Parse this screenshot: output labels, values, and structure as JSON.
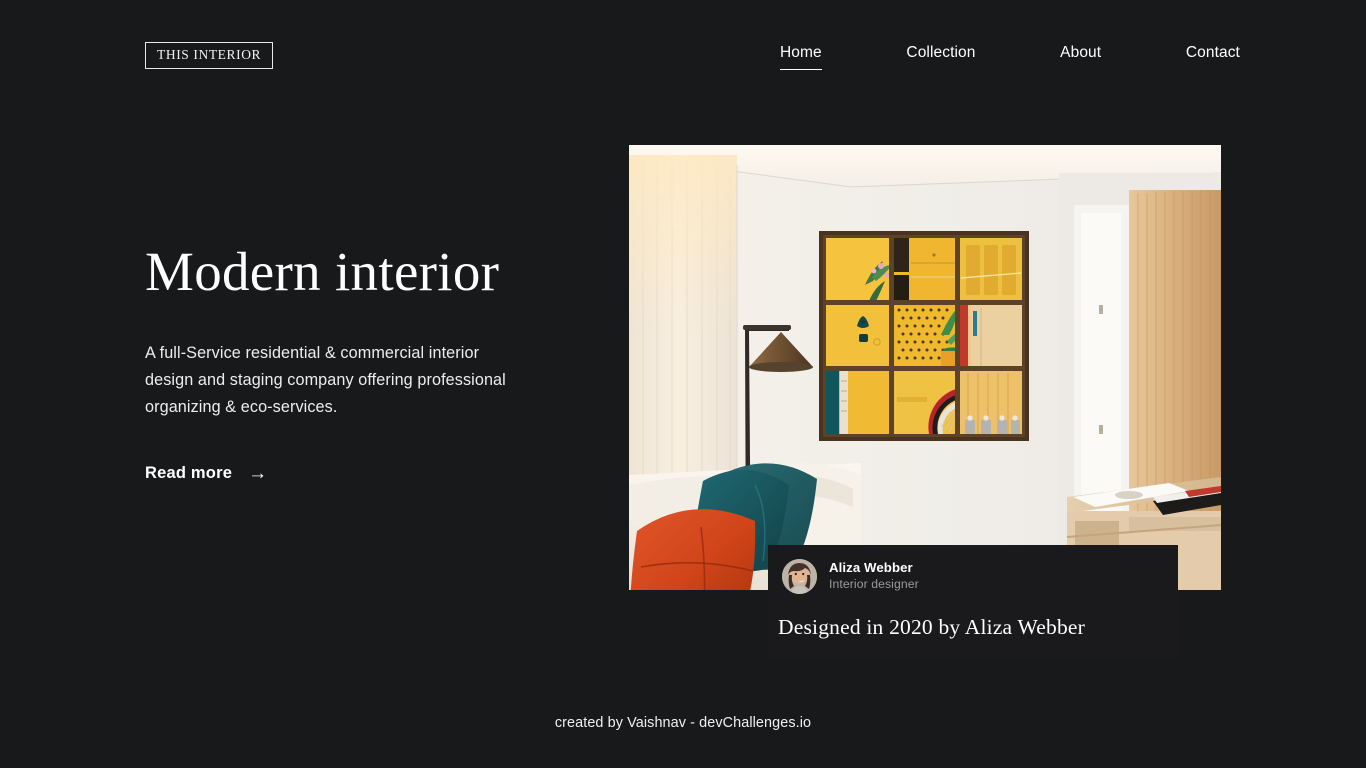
{
  "header": {
    "logo": "THIS INTERIOR",
    "nav": [
      {
        "label": "Home",
        "active": true
      },
      {
        "label": "Collection",
        "active": false
      },
      {
        "label": "About",
        "active": false
      },
      {
        "label": "Contact",
        "active": false
      }
    ]
  },
  "hero": {
    "title": "Modern interior",
    "subtitle": "A full-Service residential & commercial interior design and staging company offering professional organizing & eco-services.",
    "cta_label": "Read more",
    "cta_icon": "arrow-right-icon",
    "image_alt": "Modern living room with white sofa, orange and teal cushions, floor lamp and grid of yellow framed photographs"
  },
  "designer_card": {
    "avatar_alt": "Portrait of Aliza Webber",
    "name": "Aliza Webber",
    "role": "Interior designer",
    "caption": "Designed in 2020 by Aliza Webber"
  },
  "footer": {
    "credit": "created by Vaishnav - devChallenges.io"
  },
  "colors": {
    "background": "#18191a",
    "card_background": "#1a1a1c",
    "text_primary": "#ffffff",
    "text_muted": "#9a9a9a",
    "accent_yellow": "#f2b712",
    "accent_orange": "#d1491f",
    "accent_teal": "#1d5c63"
  }
}
